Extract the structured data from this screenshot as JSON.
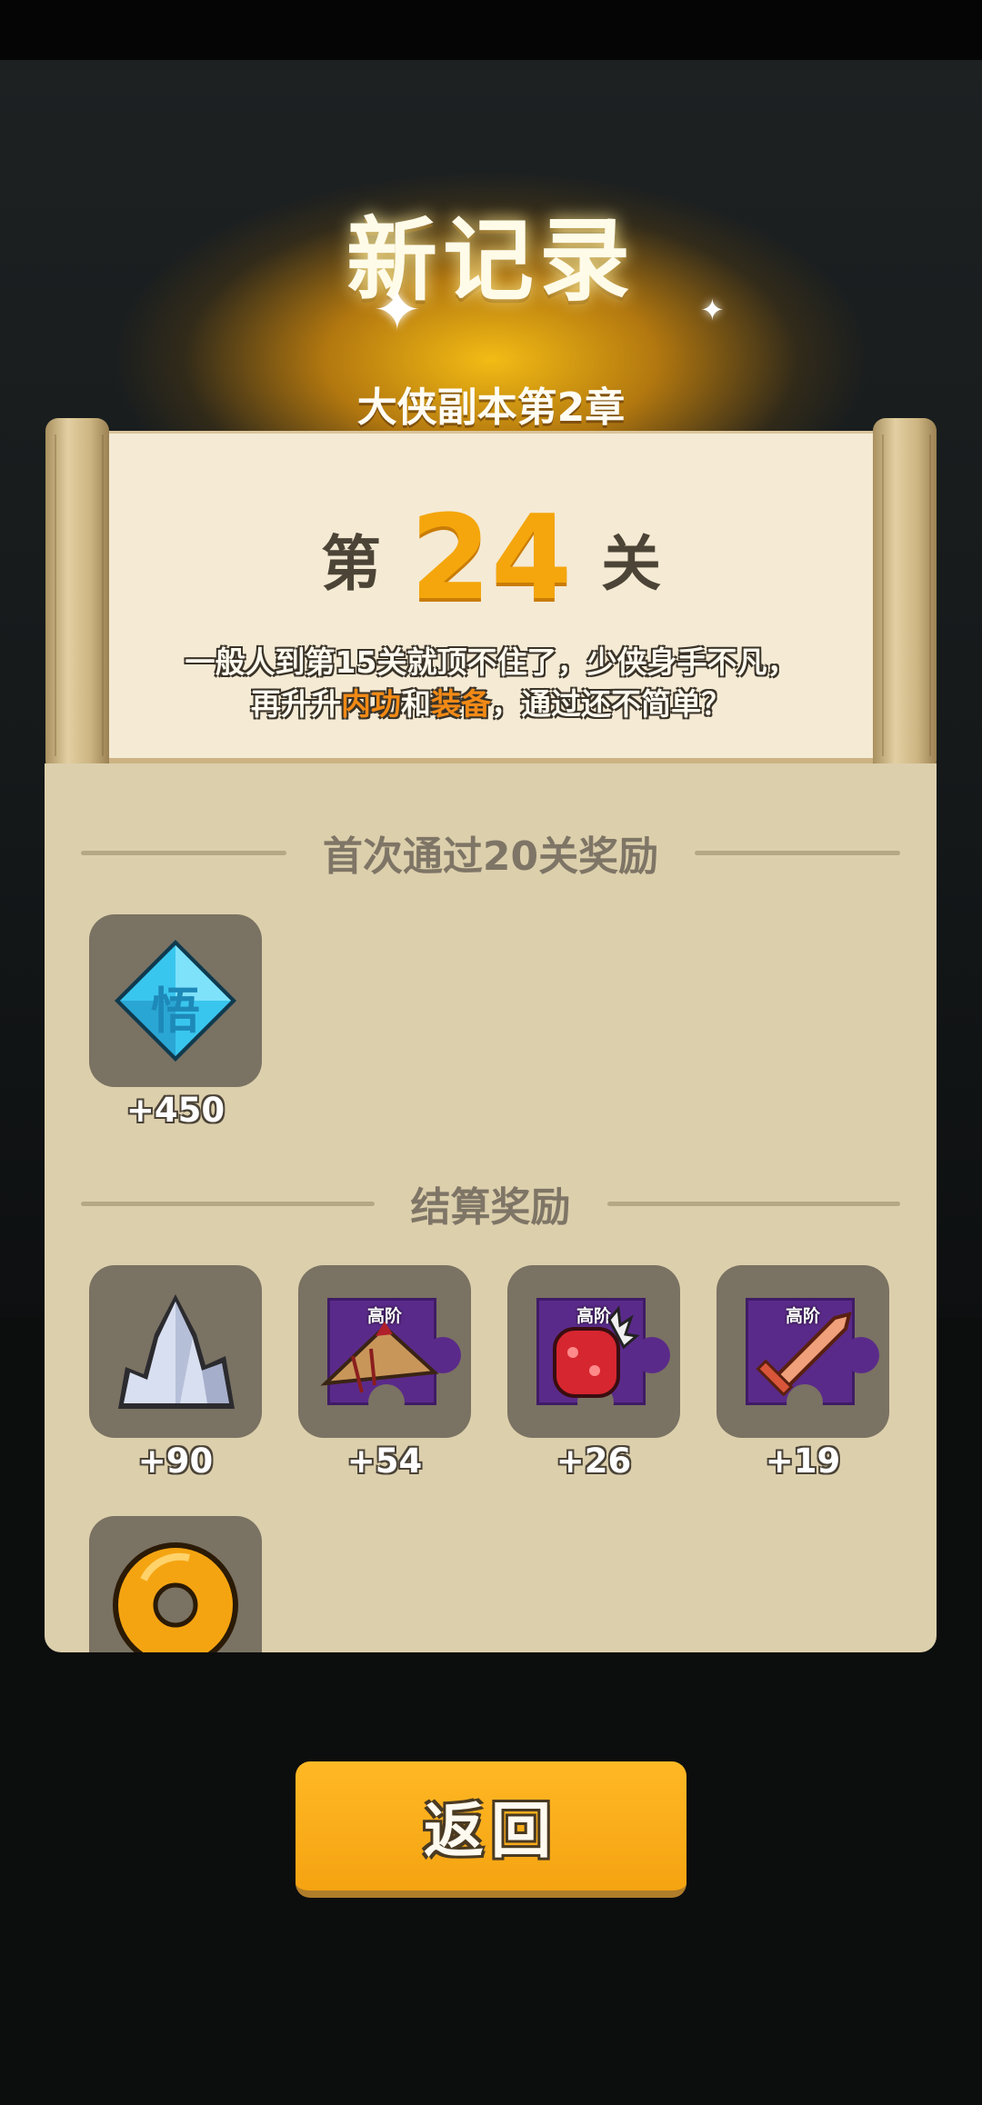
{
  "header": {
    "title": "新记录",
    "subtitle": "大侠副本第2章"
  },
  "stage": {
    "prefix": "第",
    "number": "24",
    "suffix": "关",
    "desc_line1": "一般人到第15关就顶不住了，少侠身手不凡，",
    "desc_line2_a": "再升升",
    "desc_line2_hl1": "内功",
    "desc_line2_b": "和",
    "desc_line2_hl2": "装备",
    "desc_line2_c": "，通过还不简单？"
  },
  "first_clear": {
    "title": "首次通过20关奖励",
    "items": [
      {
        "icon": "wisdom-gem-icon",
        "glyph": "悟",
        "qty": "+450"
      }
    ]
  },
  "settlement": {
    "title": "结算奖励",
    "items": [
      {
        "icon": "crystal-ore-icon",
        "qty": "+90"
      },
      {
        "icon": "bamboo-hat-fragment-icon",
        "tier": "高阶",
        "qty": "+54"
      },
      {
        "icon": "gauntlet-fragment-icon",
        "tier": "高阶",
        "qty": "+26"
      },
      {
        "icon": "sword-fragment-icon",
        "tier": "高阶",
        "qty": "+19"
      },
      {
        "icon": "gold-coin-icon"
      }
    ]
  },
  "actions": {
    "back_label": "返回"
  },
  "colors": {
    "accent": "#f4a60c",
    "highlight": "#f28a16",
    "panel": "#dccfac",
    "tile": "#7a7262",
    "button": "#f5a311"
  }
}
